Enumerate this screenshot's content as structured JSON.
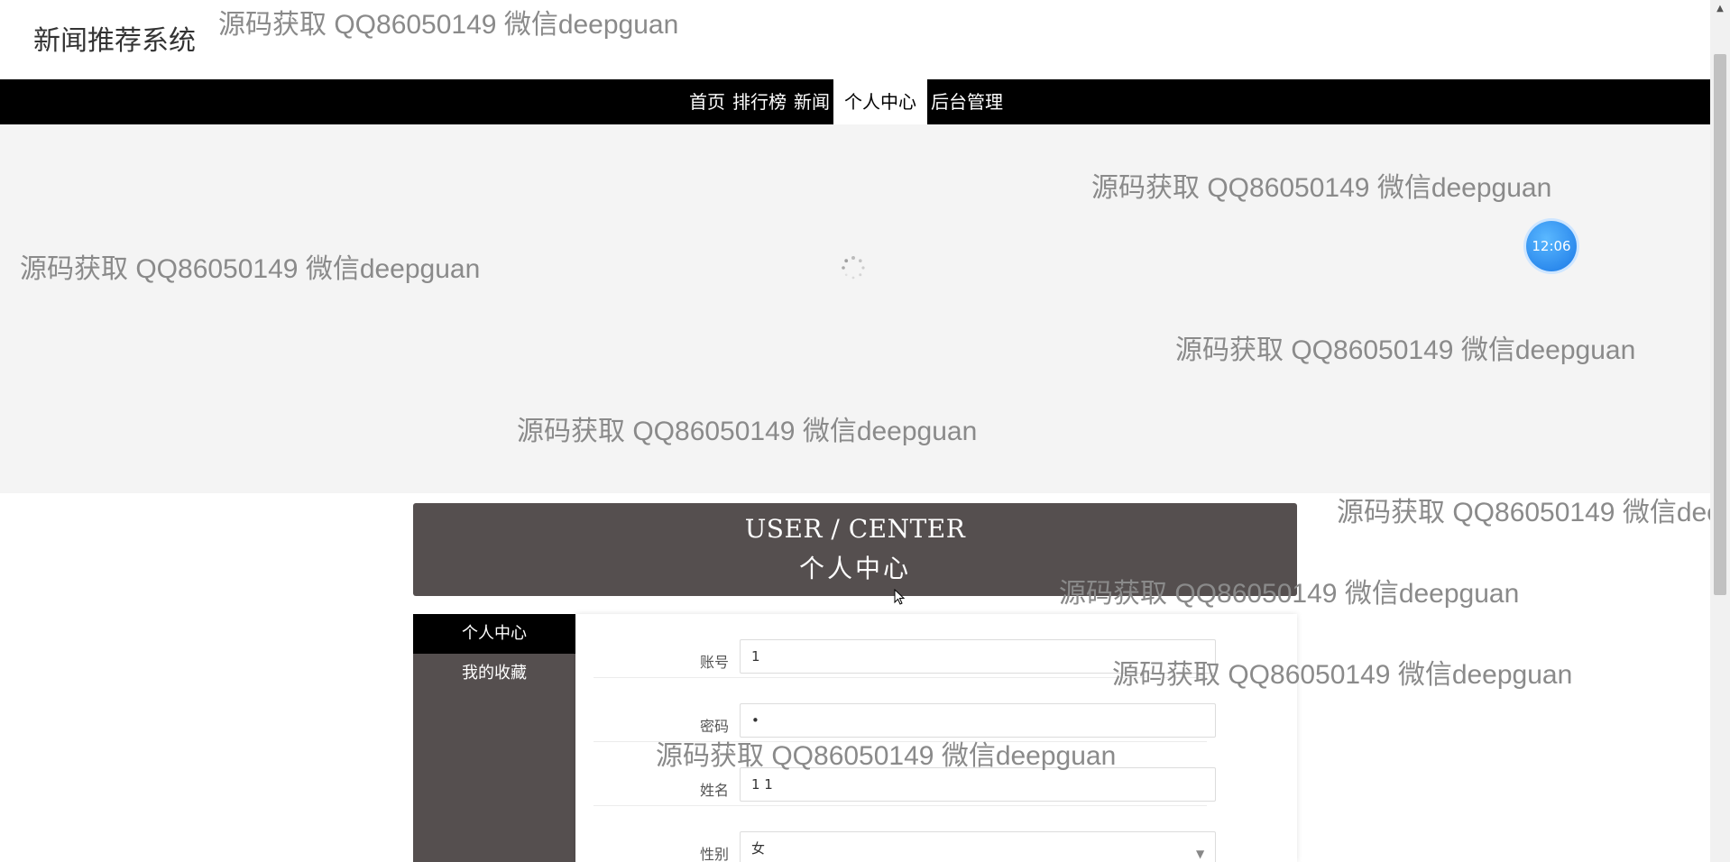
{
  "site": {
    "title": "新闻推荐系统"
  },
  "nav": {
    "items": [
      "首页",
      "排行榜",
      "新闻",
      "个人中心",
      "后台管理"
    ],
    "active_index": 3
  },
  "carousel": {
    "clock_time": "12:06"
  },
  "watermarks": [
    "源码获取 QQ86050149 微信deepguan",
    "源码获取 QQ86050149 微信deepguan",
    "源码获取 QQ86050149 微信deepguan",
    "源码获取 QQ86050149 微信deepguan",
    "源码获取 QQ86050149 微信deepguan",
    "源码获取 QQ86050149 微信dee",
    "源码获取 QQ86050149 微信deepguan",
    "源码获取 QQ86050149 微信deepguan",
    "源码获取 QQ86050149 微信deepguan"
  ],
  "user_center": {
    "title_en": "USER / CENTER",
    "title_cn": "个人中心"
  },
  "side_menu": {
    "items": [
      "个人中心",
      "我的收藏"
    ],
    "active_index": 0
  },
  "form": {
    "account_label": "账号",
    "account_value": "1",
    "password_label": "密码",
    "password_value": "•",
    "name_label": "姓名",
    "name_value": "1 1",
    "gender_label": "性别",
    "gender_value": "女"
  },
  "colors": {
    "nav_bg": "#000000",
    "banner_bg": "#554f4f",
    "clock_blue": "#1a78e6"
  }
}
